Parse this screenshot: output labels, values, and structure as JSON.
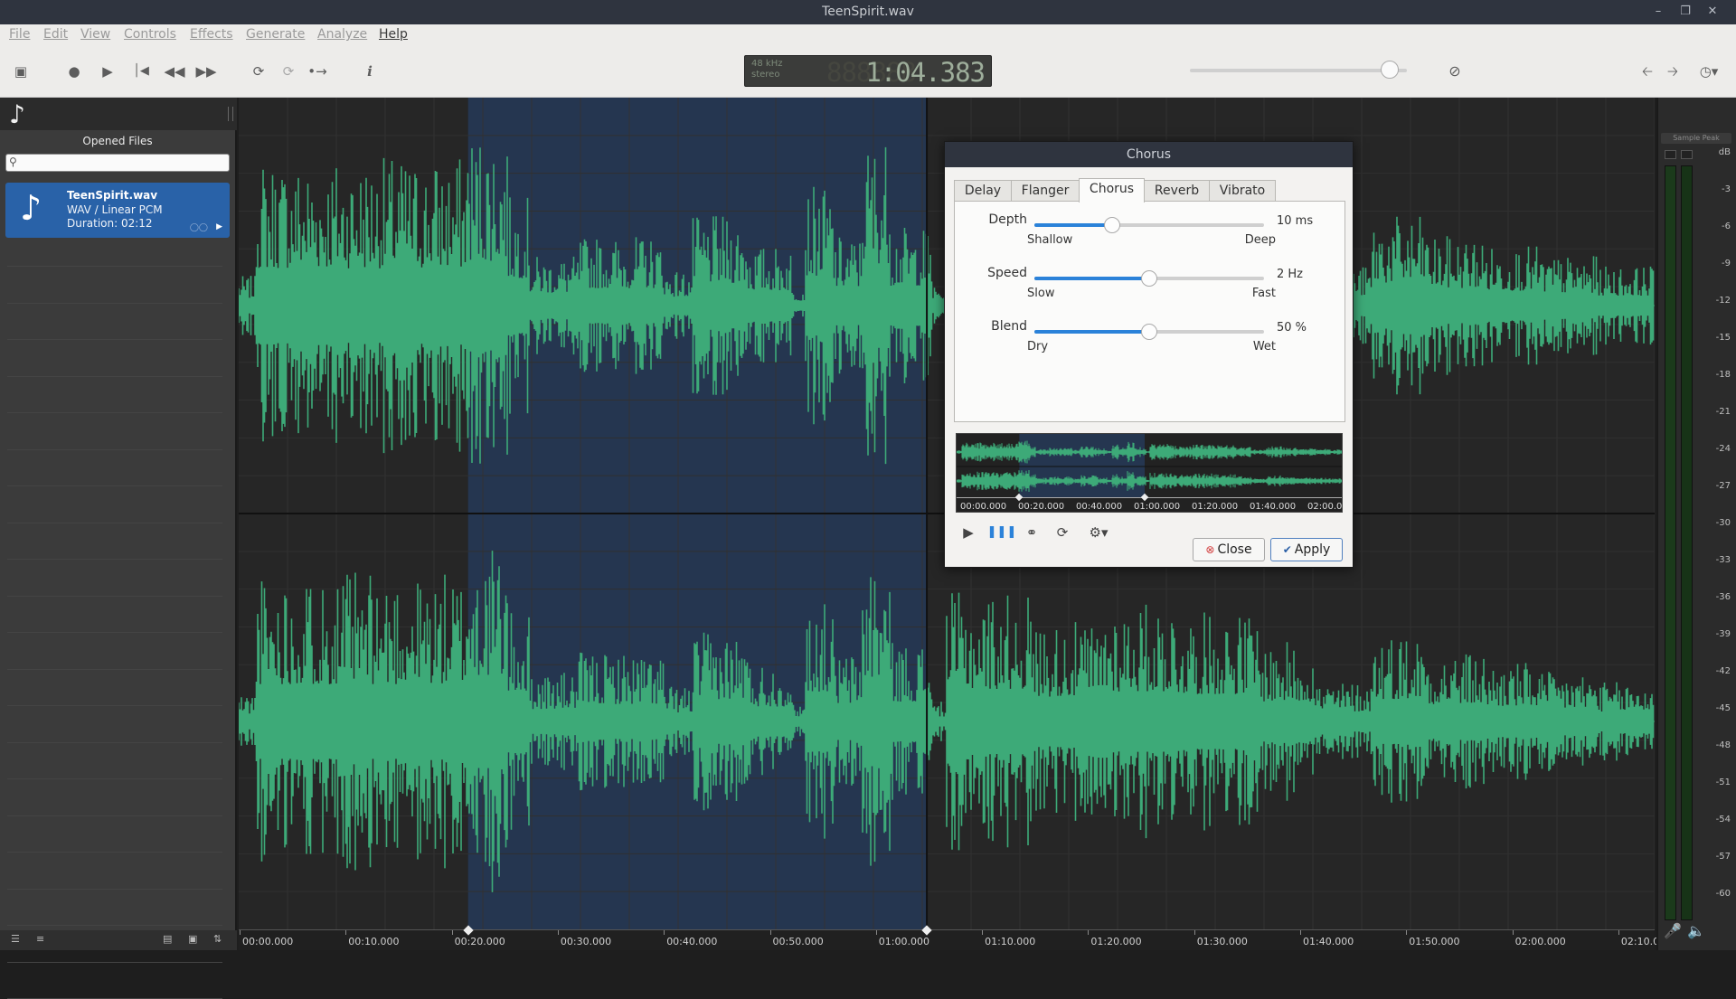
{
  "window": {
    "title": "TeenSpirit.wav"
  },
  "menu": [
    {
      "label": "File",
      "enabled": false
    },
    {
      "label": "Edit",
      "enabled": false
    },
    {
      "label": "View",
      "enabled": false
    },
    {
      "label": "Controls",
      "enabled": false
    },
    {
      "label": "Effects",
      "enabled": false
    },
    {
      "label": "Generate",
      "enabled": false
    },
    {
      "label": "Analyze",
      "enabled": false
    },
    {
      "label": "Help",
      "enabled": true
    }
  ],
  "toolbar": {
    "icons": [
      "sidebar-toggle-icon",
      "record-icon",
      "play-icon",
      "skip-start-icon",
      "rewind-icon",
      "fast-forward-icon",
      "loop-icon",
      "repeat-icon",
      "follow-cursor-icon",
      "info-icon"
    ],
    "lcd": {
      "rate": "48 kHz",
      "channels": "stereo",
      "time": "1:04.383"
    },
    "volume": 0.92,
    "right_icons": [
      "muted-speaker-icon",
      "arrow-left-icon",
      "arrow-right-icon",
      "history-icon"
    ]
  },
  "sidebar": {
    "section": "Opened Files",
    "search_placeholder": "",
    "file": {
      "name": "TeenSpirit.wav",
      "format": "WAV / Linear PCM",
      "duration": "Duration: 02:12"
    }
  },
  "timeline": {
    "labels": [
      "00:00.000",
      "00:10.000",
      "00:20.000",
      "00:30.000",
      "00:40.000",
      "00:50.000",
      "01:00.000",
      "01:10.000",
      "01:20.000",
      "01:30.000",
      "01:40.000",
      "01:50.000",
      "02:00.000",
      "02:10.0"
    ],
    "selection_start": 0.162,
    "selection_end": 0.486,
    "waveform_color": "#3daa78",
    "selection_color": "#253650"
  },
  "meters": {
    "label": "Sample Peak",
    "unit": "dB",
    "ticks": [
      "-3",
      "-6",
      "-9",
      "-12",
      "-15",
      "-18",
      "-21",
      "-24",
      "-27",
      "-30",
      "-33",
      "-36",
      "-39",
      "-42",
      "-45",
      "-48",
      "-51",
      "-54",
      "-57",
      "-60"
    ]
  },
  "dialog": {
    "title": "Chorus",
    "tabs": [
      "Delay",
      "Flanger",
      "Chorus",
      "Reverb",
      "Vibrato"
    ],
    "active_tab": 2,
    "params": [
      {
        "name": "Depth",
        "value": "10 ms",
        "low": "Shallow",
        "high": "Deep",
        "level": 0.34
      },
      {
        "name": "Speed",
        "value": "2 Hz",
        "low": "Slow",
        "high": "Fast",
        "level": 0.5
      },
      {
        "name": "Blend",
        "value": "50 %",
        "low": "Dry",
        "high": "Wet",
        "level": 0.5
      }
    ],
    "preview_labels": [
      "00:00.000",
      "00:20.000",
      "00:40.000",
      "01:00.000",
      "01:20.000",
      "01:40.000",
      "02:00.000"
    ],
    "close_label": "Close",
    "apply_label": "Apply"
  }
}
